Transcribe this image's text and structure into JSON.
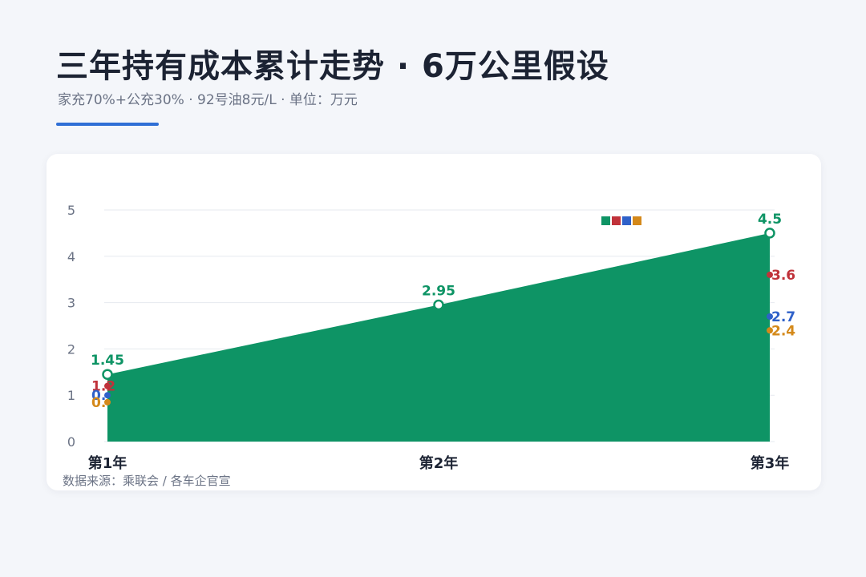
{
  "header": {
    "title": "三年持有成本累计走势 · 6万公里假设",
    "subtitle": "家充70%+公充30% · 92号油8元/L · 单位：万元"
  },
  "footer": {
    "source": "数据来源：乘联会 / 各车企官宣"
  },
  "colors": {
    "accent": "#2f6fd6",
    "green": "#0e9465",
    "red": "#c0323a",
    "blue": "#2f61c9",
    "orange": "#d4891a",
    "grid": "#e6e9ef"
  },
  "chart_data": {
    "type": "area",
    "categories": [
      "第1年",
      "第2年",
      "第3年"
    ],
    "ylim": [
      0,
      5
    ],
    "yticks": [
      0,
      1,
      2,
      3,
      4,
      5
    ],
    "grid": true,
    "legend": "top-right",
    "series": [
      {
        "values": [
          1.45,
          2.95,
          4.5
        ],
        "labels": [
          "1.45",
          "2.95",
          "4.5"
        ],
        "color": "#0e9465",
        "fill": true
      },
      {
        "values": [
          1.2,
          null,
          3.6
        ],
        "labels": [
          "1.2",
          "",
          "3.6"
        ],
        "color": "#c0323a",
        "fill": false
      },
      {
        "values": [
          1.0,
          null,
          2.7
        ],
        "labels": [
          "0.",
          "",
          "2.7"
        ],
        "color": "#2f61c9",
        "fill": false
      },
      {
        "values": [
          0.85,
          null,
          2.4
        ],
        "labels": [
          "0.",
          "",
          "2.4"
        ],
        "color": "#d4891a",
        "fill": false
      }
    ]
  }
}
